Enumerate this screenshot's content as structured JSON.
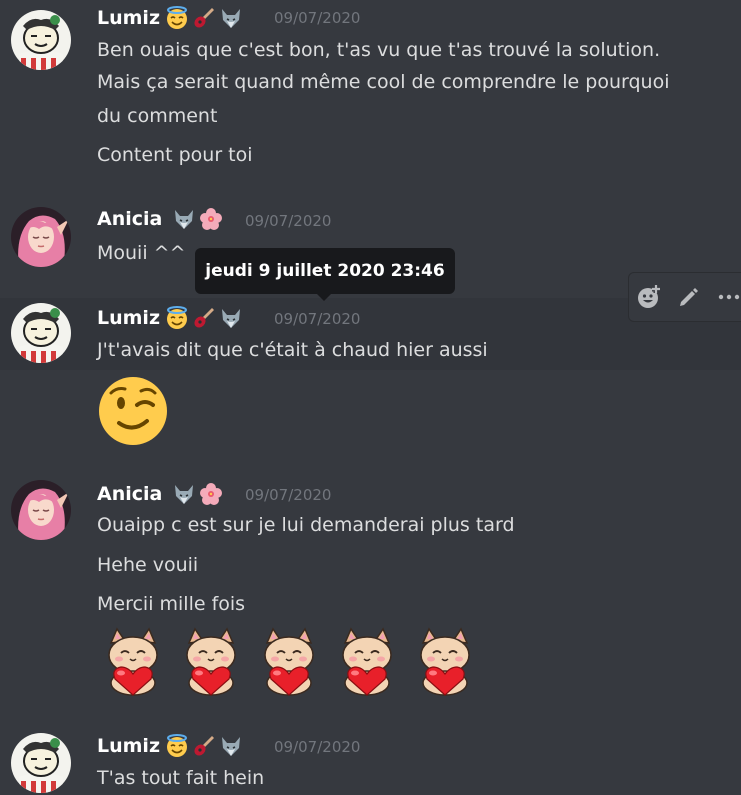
{
  "tooltip": {
    "text": "jeudi 9 juillet 2020 23:46"
  },
  "toolbar": {
    "actions": [
      "add-reaction-icon",
      "edit-icon",
      "more-icon"
    ]
  },
  "messages": [
    {
      "username": "Lumiz",
      "badges": [
        "halo-emoji",
        "guitar-emoji",
        "wolf-emoji"
      ],
      "timestamp": "09/07/2020",
      "lines": [
        "Ben ouais que c'est bon, t'as vu que t'as trouvé la solution.",
        "Mais ça serait quand même cool de comprendre le pourquoi",
        "du comment",
        "Content pour toi"
      ]
    },
    {
      "username": "Anicia",
      "badges": [
        "wolf-emoji",
        "hibiscus-emoji"
      ],
      "timestamp": "09/07/2020",
      "lines": [
        "Mouii ^^"
      ]
    },
    {
      "username": "Lumiz",
      "badges": [
        "halo-emoji",
        "guitar-emoji",
        "wolf-emoji"
      ],
      "timestamp": "09/07/2020",
      "lines": [
        "J't'avais dit que c'était à chaud hier aussi"
      ],
      "emoji": "winking-face"
    },
    {
      "username": "Anicia",
      "badges": [
        "wolf-emoji",
        "hibiscus-emoji"
      ],
      "timestamp": "09/07/2020",
      "lines": [
        "Ouaipp c est sur je lui demanderai plus tard",
        "Hehe vouii",
        "Mercii mille fois"
      ],
      "stickers": [
        "cat-heart",
        "cat-heart",
        "cat-heart",
        "cat-heart",
        "cat-heart"
      ]
    },
    {
      "username": "Lumiz",
      "badges": [
        "halo-emoji",
        "guitar-emoji",
        "wolf-emoji"
      ],
      "timestamp": "09/07/2020",
      "lines": [
        "T'as tout fait hein"
      ]
    }
  ],
  "colors": {
    "background": "#36393f",
    "hover": "#32353b",
    "username": "#ffffff",
    "text": "#dcddde",
    "timestamp": "#72767d",
    "tooltip": "#18191c"
  }
}
